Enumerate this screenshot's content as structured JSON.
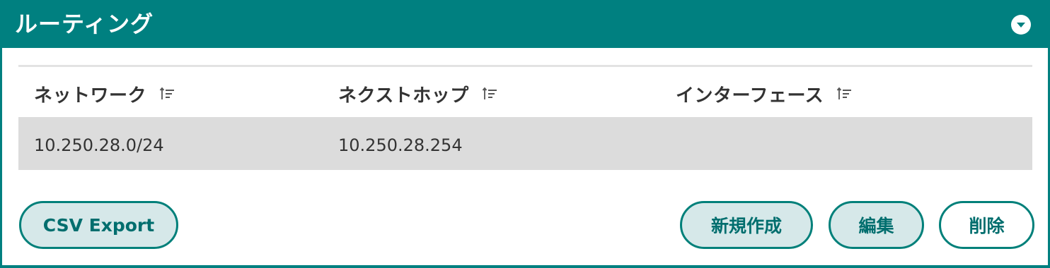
{
  "panel": {
    "title": "ルーティング",
    "toggle_icon": "chevron-down-circle-icon"
  },
  "table": {
    "columns": [
      {
        "label": "ネットワーク",
        "sort_icon": "sort-icon"
      },
      {
        "label": "ネクストホップ",
        "sort_icon": "sort-icon"
      },
      {
        "label": "インターフェース",
        "sort_icon": "sort-icon"
      }
    ],
    "rows": [
      {
        "network": "10.250.28.0/24",
        "next_hop": "10.250.28.254",
        "interface": ""
      }
    ]
  },
  "actions": {
    "csv_export": "CSV Export",
    "create": "新規作成",
    "edit": "編集",
    "delete": "削除"
  },
  "colors": {
    "accent": "#008080",
    "row_background": "#dcdcdc",
    "button_background": "#d6e8e9",
    "button_text": "#006e6e"
  }
}
